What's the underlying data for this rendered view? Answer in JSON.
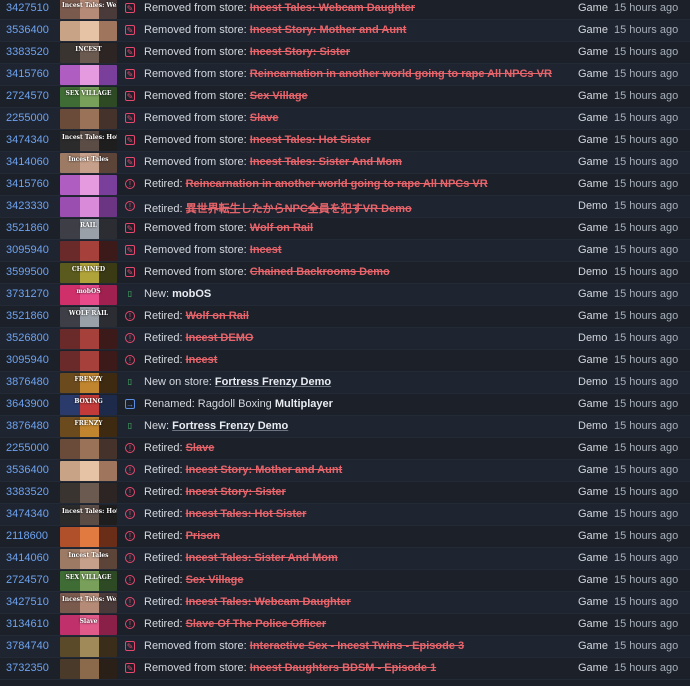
{
  "rows": [
    {
      "appid": "3427510",
      "event": "removed",
      "prefix": "Removed from store: ",
      "name": "Incest Tales: Webcam Daughter",
      "style": "gone",
      "type": "Game",
      "time": "15 hours ago",
      "thumb_text": "Incest Tales: Webcam Daughter",
      "thumb_colors": [
        "#7b5a4e",
        "#b58b78",
        "#4a3a3a"
      ]
    },
    {
      "appid": "3536400",
      "event": "removed",
      "prefix": "Removed from store: ",
      "name": "Incest Story: Mother and Aunt",
      "style": "gone",
      "type": "Game",
      "time": "15 hours ago",
      "thumb_text": "",
      "thumb_colors": [
        "#c9a385",
        "#e6c3a4",
        "#a0755e"
      ]
    },
    {
      "appid": "3383520",
      "event": "removed",
      "prefix": "Removed from store: ",
      "name": "Incest Story: Sister",
      "style": "gone",
      "type": "Game",
      "time": "15 hours ago",
      "thumb_text": "INCEST",
      "thumb_colors": [
        "#3a3431",
        "#6b5a50",
        "#2c2523"
      ]
    },
    {
      "appid": "3415760",
      "event": "removed",
      "prefix": "Removed from store: ",
      "name": "Reincarnation in another world going to rape All NPCs VR",
      "style": "gone",
      "type": "Game",
      "time": "15 hours ago",
      "thumb_text": "",
      "thumb_colors": [
        "#b05dc2",
        "#e59ae0",
        "#7a3f9a"
      ]
    },
    {
      "appid": "2724570",
      "event": "removed",
      "prefix": "Removed from store: ",
      "name": "Sex Village",
      "style": "gone",
      "type": "Game",
      "time": "15 hours ago",
      "thumb_text": "SEX VILLAGE",
      "thumb_colors": [
        "#3f6b34",
        "#78a05a",
        "#2d4a25"
      ]
    },
    {
      "appid": "2255000",
      "event": "removed",
      "prefix": "Removed from store: ",
      "name": "Slave",
      "style": "gone",
      "type": "Game",
      "time": "15 hours ago",
      "thumb_text": "",
      "thumb_colors": [
        "#6a4a38",
        "#9a7258",
        "#45322a"
      ]
    },
    {
      "appid": "3474340",
      "event": "removed",
      "prefix": "Removed from store: ",
      "name": "Incest Tales: Hot Sister",
      "style": "gone",
      "type": "Game",
      "time": "15 hours ago",
      "thumb_text": "Incest Tales: Hot Sister",
      "thumb_colors": [
        "#2b2b2b",
        "#5b4c46",
        "#1e1e1e"
      ]
    },
    {
      "appid": "3414060",
      "event": "removed",
      "prefix": "Removed from store: ",
      "name": "Incest Tales: Sister And Mom",
      "style": "gone",
      "type": "Game",
      "time": "15 hours ago",
      "thumb_text": "Incest Tales",
      "thumb_colors": [
        "#9c7a64",
        "#c6a08a",
        "#5c4438"
      ]
    },
    {
      "appid": "3415760",
      "event": "retired",
      "prefix": "Retired: ",
      "name": "Reincarnation in another world going to rape All NPCs VR",
      "style": "gone",
      "type": "Game",
      "time": "15 hours ago",
      "thumb_text": "",
      "thumb_colors": [
        "#b05dc2",
        "#e59ae0",
        "#7a3f9a"
      ]
    },
    {
      "appid": "3423330",
      "event": "retired",
      "prefix": "Retired: ",
      "name": "異世界転生したからNPC全員を犯すVR Demo",
      "style": "gone",
      "type": "Demo",
      "time": "15 hours ago",
      "thumb_text": "",
      "thumb_colors": [
        "#9a4fb0",
        "#d98ad9",
        "#6c3584"
      ]
    },
    {
      "appid": "3521860",
      "event": "removed",
      "prefix": "Removed from store: ",
      "name": "Wolf on Rail",
      "style": "gone",
      "type": "Game",
      "time": "15 hours ago",
      "thumb_text": "RAIL",
      "thumb_colors": [
        "#3e3e46",
        "#9aa0a8",
        "#2c2c33"
      ]
    },
    {
      "appid": "3095940",
      "event": "removed",
      "prefix": "Removed from store: ",
      "name": "Incest",
      "style": "gone",
      "type": "Game",
      "time": "15 hours ago",
      "thumb_text": "",
      "thumb_colors": [
        "#6a2a2a",
        "#a5403a",
        "#3c1a1a"
      ]
    },
    {
      "appid": "3599500",
      "event": "removed",
      "prefix": "Removed from store: ",
      "name": "Chained Backrooms Demo",
      "style": "gone",
      "type": "Demo",
      "time": "15 hours ago",
      "thumb_text": "CHAINED",
      "thumb_colors": [
        "#5a5a1e",
        "#b0a33a",
        "#3a3a14"
      ]
    },
    {
      "appid": "3731270",
      "event": "new",
      "prefix": "New: ",
      "name": "mobOS",
      "style": "plain",
      "type": "Game",
      "time": "15 hours ago",
      "thumb_text": "mobOS",
      "thumb_colors": [
        "#d0306a",
        "#e84a8a",
        "#a0204f"
      ]
    },
    {
      "appid": "3521860",
      "event": "retired",
      "prefix": "Retired: ",
      "name": "Wolf on Rail",
      "style": "gone",
      "type": "Game",
      "time": "15 hours ago",
      "thumb_text": "WOLF RAIL",
      "thumb_colors": [
        "#3e3e46",
        "#9aa0a8",
        "#2c2c33"
      ]
    },
    {
      "appid": "3526800",
      "event": "retired",
      "prefix": "Retired: ",
      "name": "Incest DEMO",
      "style": "gone",
      "type": "Demo",
      "time": "15 hours ago",
      "thumb_text": "",
      "thumb_colors": [
        "#6a2a2a",
        "#a5403a",
        "#3c1a1a"
      ]
    },
    {
      "appid": "3095940",
      "event": "retired",
      "prefix": "Retired: ",
      "name": "Incest",
      "style": "gone",
      "type": "Game",
      "time": "15 hours ago",
      "thumb_text": "",
      "thumb_colors": [
        "#6a2a2a",
        "#a5403a",
        "#3c1a1a"
      ]
    },
    {
      "appid": "3876480",
      "event": "new",
      "prefix": "New on store: ",
      "name": "Fortress Frenzy Demo",
      "style": "live",
      "type": "Demo",
      "time": "15 hours ago",
      "thumb_text": "FRENZY",
      "thumb_colors": [
        "#6b4a1e",
        "#c0852e",
        "#3d2a10"
      ]
    },
    {
      "appid": "3643900",
      "event": "renamed",
      "prefix": "Renamed: Ragdoll Boxing ",
      "name": "Multiplayer",
      "style": "plain",
      "type": "Game",
      "time": "15 hours ago",
      "thumb_text": "BOXING",
      "thumb_colors": [
        "#2a3a6a",
        "#c23a3a",
        "#1e2a4a"
      ]
    },
    {
      "appid": "3876480",
      "event": "new",
      "prefix": "New: ",
      "name": "Fortress Frenzy Demo",
      "style": "live",
      "type": "Demo",
      "time": "15 hours ago",
      "thumb_text": "FRENZY",
      "thumb_colors": [
        "#6b4a1e",
        "#c0852e",
        "#3d2a10"
      ]
    },
    {
      "appid": "2255000",
      "event": "retired",
      "prefix": "Retired: ",
      "name": "Slave",
      "style": "gone",
      "type": "Game",
      "time": "15 hours ago",
      "thumb_text": "",
      "thumb_colors": [
        "#6a4a38",
        "#9a7258",
        "#45322a"
      ]
    },
    {
      "appid": "3536400",
      "event": "retired",
      "prefix": "Retired: ",
      "name": "Incest Story: Mother and Aunt",
      "style": "gone",
      "type": "Game",
      "time": "15 hours ago",
      "thumb_text": "",
      "thumb_colors": [
        "#c9a385",
        "#e6c3a4",
        "#a0755e"
      ]
    },
    {
      "appid": "3383520",
      "event": "retired",
      "prefix": "Retired: ",
      "name": "Incest Story: Sister",
      "style": "gone",
      "type": "Game",
      "time": "15 hours ago",
      "thumb_text": "",
      "thumb_colors": [
        "#3a3431",
        "#6b5a50",
        "#2c2523"
      ]
    },
    {
      "appid": "3474340",
      "event": "retired",
      "prefix": "Retired: ",
      "name": "Incest Tales: Hot Sister",
      "style": "gone",
      "type": "Game",
      "time": "15 hours ago",
      "thumb_text": "Incest Tales: Hot Sister",
      "thumb_colors": [
        "#2b2b2b",
        "#5b4c46",
        "#1e1e1e"
      ]
    },
    {
      "appid": "2118600",
      "event": "retired",
      "prefix": "Retired: ",
      "name": "Prison",
      "style": "gone",
      "type": "Game",
      "time": "15 hours ago",
      "thumb_text": "",
      "thumb_colors": [
        "#b0502a",
        "#e07a40",
        "#6a2e18"
      ]
    },
    {
      "appid": "3414060",
      "event": "retired",
      "prefix": "Retired: ",
      "name": "Incest Tales: Sister And Mom",
      "style": "gone",
      "type": "Game",
      "time": "15 hours ago",
      "thumb_text": "Incest Tales",
      "thumb_colors": [
        "#9c7a64",
        "#c6a08a",
        "#5c4438"
      ]
    },
    {
      "appid": "2724570",
      "event": "retired",
      "prefix": "Retired: ",
      "name": "Sex Village",
      "style": "gone",
      "type": "Game",
      "time": "15 hours ago",
      "thumb_text": "SEX VILLAGE",
      "thumb_colors": [
        "#3f6b34",
        "#78a05a",
        "#2d4a25"
      ]
    },
    {
      "appid": "3427510",
      "event": "retired",
      "prefix": "Retired: ",
      "name": "Incest Tales: Webcam Daughter",
      "style": "gone",
      "type": "Game",
      "time": "15 hours ago",
      "thumb_text": "Incest Tales: Webcam Daughter",
      "thumb_colors": [
        "#7b5a4e",
        "#b58b78",
        "#4a3a3a"
      ]
    },
    {
      "appid": "3134610",
      "event": "retired",
      "prefix": "Retired: ",
      "name": "Slave Of The Police Officer",
      "style": "gone",
      "type": "Game",
      "time": "15 hours ago",
      "thumb_text": "Slave",
      "thumb_colors": [
        "#c0306a",
        "#e05a8a",
        "#8a2048"
      ]
    },
    {
      "appid": "3784740",
      "event": "removed",
      "prefix": "Removed from store: ",
      "name": "Interactive Sex - Incest Twins - Episode 3",
      "style": "gone",
      "type": "Game",
      "time": "15 hours ago",
      "thumb_text": "",
      "thumb_colors": [
        "#5a4a2a",
        "#a08a5a",
        "#3a2e1a"
      ]
    },
    {
      "appid": "3732350",
      "event": "removed",
      "prefix": "Removed from store: ",
      "name": "Incest Daughters BDSM - Episode 1",
      "style": "gone",
      "type": "Game",
      "time": "15 hours ago",
      "thumb_text": "",
      "thumb_colors": [
        "#4a3a2a",
        "#8a6a4a",
        "#2a2018"
      ]
    }
  ],
  "event_glyphs": {
    "removed": "✎",
    "retired": "!",
    "new": "▯",
    "renamed": "→"
  },
  "icon_names": {
    "removed": "edit-square-icon",
    "retired": "alert-circle-icon",
    "new": "bookmark-icon",
    "renamed": "arrow-right-square-icon"
  }
}
